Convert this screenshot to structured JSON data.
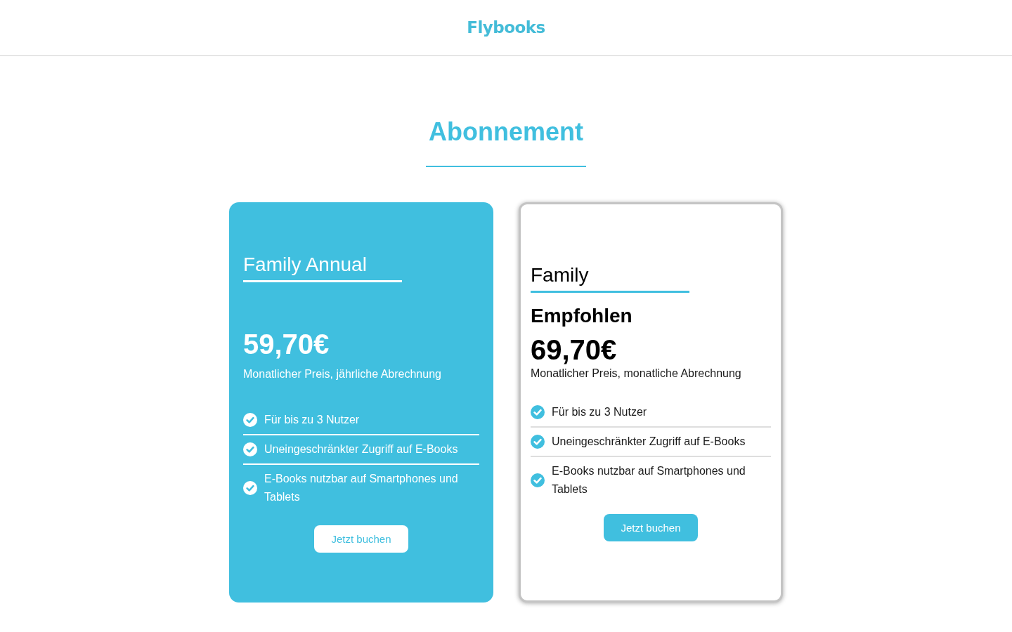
{
  "header": {
    "logo": "Flybooks"
  },
  "title": "Abonnement",
  "plans": [
    {
      "name": "Family Annual",
      "selected": true,
      "price": "59,70€",
      "billing": "Monatlicher Preis, jährliche Abrechnung",
      "features": [
        "Für bis zu 3 Nutzer",
        "Uneingeschränkter Zugriff auf E-Books",
        "E-Books nutzbar auf Smartphones und Tablets"
      ],
      "button": "Jetzt buchen"
    },
    {
      "name": "Family",
      "selected": false,
      "badge": "Empfohlen",
      "price": "69,70€",
      "billing": "Monatlicher Preis, monatliche Abrechnung",
      "features": [
        "Für bis zu 3 Nutzer",
        "Uneingeschränkter Zugriff auf E-Books",
        "E-Books nutzbar auf Smartphones und Tablets"
      ],
      "button": "Jetzt buchen"
    }
  ]
}
